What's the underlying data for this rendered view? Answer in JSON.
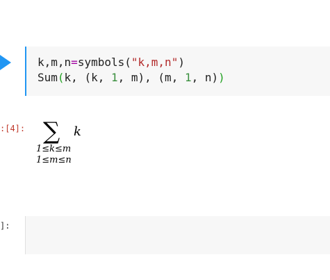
{
  "code_cell": {
    "line1": {
      "lhs": "k,m,n",
      "eq": "=",
      "fn": "symbols",
      "open": "(",
      "str": "\"k,m,n\"",
      "close": ")"
    },
    "line2": {
      "fn": "Sum",
      "open": "(",
      "a": "k, (k, ",
      "n1": "1",
      "b": ", m), (m, ",
      "n2": "1",
      "c": ", n)",
      "close": ")"
    }
  },
  "output": {
    "prompt": ":[4]:",
    "sigma": "∑",
    "argument": "k",
    "limit1": "1≤k≤m",
    "limit2": "1≤m≤n"
  },
  "next_cell": {
    "prompt": "]:"
  }
}
